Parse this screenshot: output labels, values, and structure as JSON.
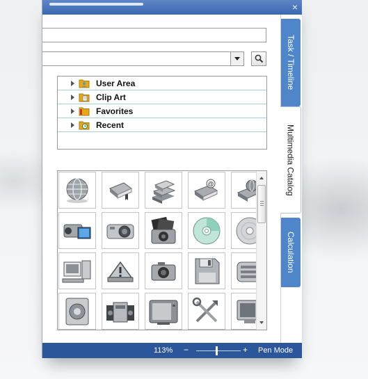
{
  "tabs": [
    {
      "label": "Task / Timeline"
    },
    {
      "label": "Multimedia Catalog"
    },
    {
      "label": "Calculation"
    }
  ],
  "title_bar": {
    "close_glyph": "×"
  },
  "tree": {
    "items": [
      {
        "label": "User Area",
        "icon": "user-folder-icon"
      },
      {
        "label": "Clip Art",
        "icon": "clipart-folder-icon"
      },
      {
        "label": "Favorites",
        "icon": "favorites-folder-icon"
      },
      {
        "label": "Recent",
        "icon": "recent-folder-icon"
      }
    ]
  },
  "gallery": {
    "items": [
      "globe-icon",
      "book-icon",
      "books-stack-icon",
      "email-book-icon",
      "globe-book-icon",
      "video-camera-icon",
      "compact-camera-icon",
      "photo-camera-icon",
      "cd-disc-icon",
      "disc-icon",
      "desktop-computer-icon",
      "warning-icon",
      "camera-icon",
      "floppy-disk-icon",
      "radio-icon",
      "speaker-icon",
      "stereo-icon",
      "television-icon",
      "tools-icon",
      "monitor-icon"
    ]
  },
  "status": {
    "zoom": "113%",
    "zoom_minus": "−",
    "zoom_plus": "+",
    "zoom_level": 0.45,
    "mode": "Pen Mode"
  },
  "colors": {
    "accent": "#2b579a",
    "tab_blue": "#4e86c9"
  }
}
